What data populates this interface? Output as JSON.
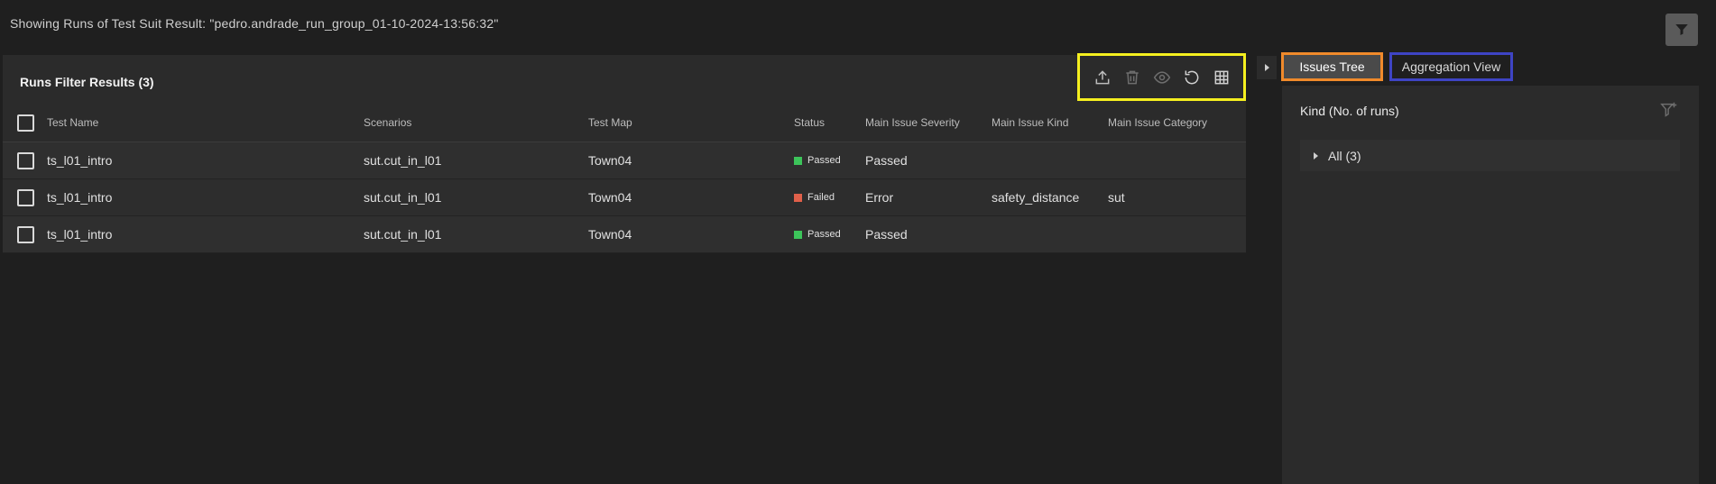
{
  "header": {
    "title": "Showing Runs of Test Suit Result: \"pedro.andrade_run_group_01-10-2024-13:56:32\"",
    "filter_icon": "funnel-icon"
  },
  "runs": {
    "title": "Runs Filter Results (3)",
    "toolbar": {
      "icons": [
        "upload-icon",
        "trash-icon",
        "eye-icon",
        "refresh-icon",
        "table-icon"
      ]
    },
    "columns": [
      "Test Name",
      "Scenarios",
      "Test Map",
      "Status",
      "Main Issue Severity",
      "Main Issue Kind",
      "Main Issue Category"
    ],
    "rows": [
      {
        "test_name": "ts_l01_intro",
        "scenario": "sut.cut_in_l01",
        "map": "Town04",
        "status": "Passed",
        "severity": "Passed",
        "kind": "",
        "category": ""
      },
      {
        "test_name": "ts_l01_intro",
        "scenario": "sut.cut_in_l01",
        "map": "Town04",
        "status": "Failed",
        "severity": "Error",
        "kind": "safety_distance",
        "category": "sut"
      },
      {
        "test_name": "ts_l01_intro",
        "scenario": "sut.cut_in_l01",
        "map": "Town04",
        "status": "Passed",
        "severity": "Passed",
        "kind": "",
        "category": ""
      }
    ],
    "status_colors": {
      "Passed": "#3cc45a",
      "Failed": "#e0604a"
    }
  },
  "tabs": {
    "issues_tree": "Issues Tree",
    "aggregation_view": "Aggregation View"
  },
  "issues": {
    "header": "Kind (No. of runs)",
    "tree": [
      {
        "label": "All (3)"
      }
    ]
  },
  "colors": {
    "toolbar_highlight": "#f5ef1f",
    "issues_tab_highlight": "#f08a2b",
    "aggregation_tab_highlight": "#3e44c4"
  }
}
